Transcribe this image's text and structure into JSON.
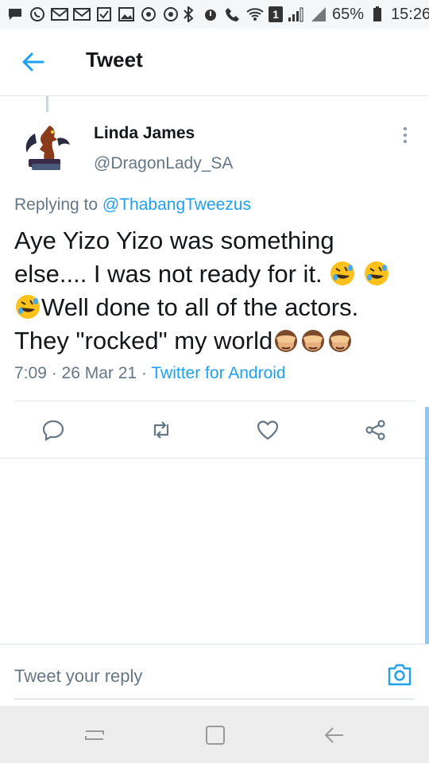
{
  "status_bar": {
    "battery": "65%",
    "time": "15:26",
    "sim_badge": "1",
    "left_icons": [
      "chat-icon",
      "whatsapp-icon",
      "gmail-icon",
      "gmail-icon",
      "checkbox-icon",
      "gallery-icon",
      "circle-icon",
      "circle-icon"
    ],
    "right_icons": [
      "bluetooth-icon",
      "alarm-icon",
      "call-icon",
      "wifi-icon",
      "signal-icon",
      "battery-icon"
    ]
  },
  "header": {
    "title": "Tweet",
    "back_icon": "arrow-left-icon"
  },
  "tweet": {
    "author_name": "Linda James",
    "author_handle": "@DragonLady_SA",
    "replying_prefix": "Replying to ",
    "replying_to": "@ThabangTweezus",
    "text_line1": "Aye Yizo Yizo was something",
    "text_line2": "else.... I was not ready for it.",
    "text_line3": "Well done to all of the actors.",
    "text_line4": "They \"rocked\" my world",
    "timestamp": "7:09 · 26 Mar 21 · ",
    "source": "Twitter for Android"
  },
  "actions": [
    "reply-icon",
    "retweet-icon",
    "like-icon",
    "share-icon"
  ],
  "reply_box": {
    "placeholder": "Tweet your reply"
  },
  "colors": {
    "accent": "#1da1f2",
    "secondary_text": "#657786",
    "primary_text": "#14171a",
    "divider": "#e1e8ed"
  }
}
